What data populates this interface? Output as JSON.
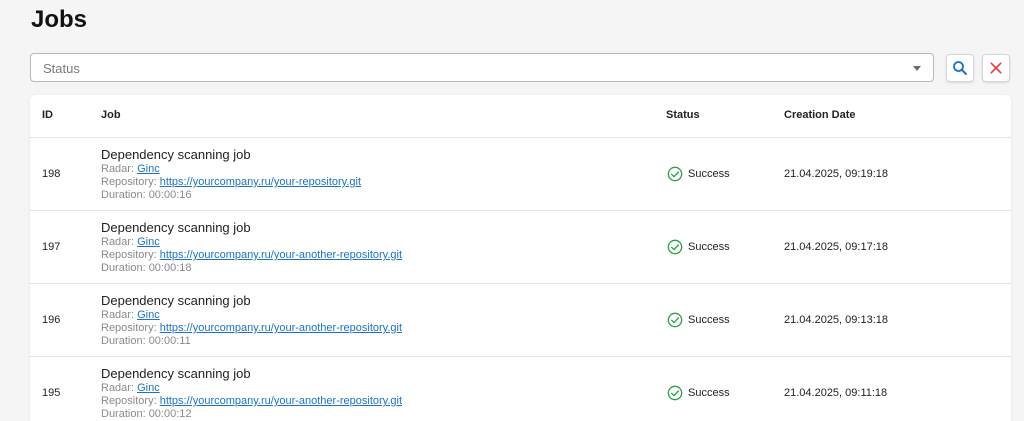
{
  "page": {
    "title": "Jobs"
  },
  "filter": {
    "placeholder": "Status"
  },
  "colors": {
    "accent": "#1a73c9",
    "success": "#2e9e4a",
    "danger": "#e53935"
  },
  "table": {
    "columns": {
      "id": "ID",
      "job": "Job",
      "status": "Status",
      "date": "Creation Date"
    },
    "rows": [
      {
        "id": "198",
        "title": "Dependency scanning job",
        "radar_label": "Radar:",
        "radar": "Ginc",
        "repo_label": "Repository:",
        "repo": "https://yourcompany.ru/your-repository.git",
        "duration": "Duration: 00:00:16",
        "status": "Success",
        "date": "21.04.2025, 09:19:18"
      },
      {
        "id": "197",
        "title": "Dependency scanning job",
        "radar_label": "Radar:",
        "radar": "Ginc",
        "repo_label": "Repository:",
        "repo": "https://yourcompany.ru/your-another-repository.git",
        "duration": "Duration: 00:00:18",
        "status": "Success",
        "date": "21.04.2025, 09:17:18"
      },
      {
        "id": "196",
        "title": "Dependency scanning job",
        "radar_label": "Radar:",
        "radar": "Ginc",
        "repo_label": "Repository:",
        "repo": "https://yourcompany.ru/your-another-repository.git",
        "duration": "Duration: 00:00:11",
        "status": "Success",
        "date": "21.04.2025, 09:13:18"
      },
      {
        "id": "195",
        "title": "Dependency scanning job",
        "radar_label": "Radar:",
        "radar": "Ginc",
        "repo_label": "Repository:",
        "repo": "https://yourcompany.ru/your-another-repository.git",
        "duration": "Duration: 00:00:12",
        "status": "Success",
        "date": "21.04.2025, 09:11:18"
      }
    ]
  }
}
